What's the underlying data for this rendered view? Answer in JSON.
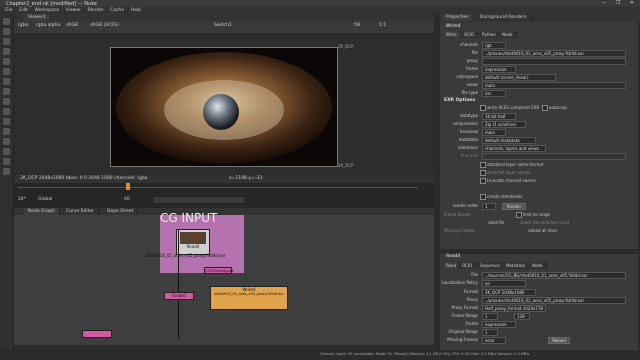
{
  "window": {
    "title": "Chapter2_end.nk [modified] — Nuke"
  },
  "menu": [
    "File",
    "Edit",
    "Workspace",
    "Viewer",
    "Render",
    "Cache",
    "Help"
  ],
  "viewer": {
    "tab_label": "Viewer1",
    "channels": "rgba",
    "channel": "rgba.alpha",
    "colorspace": "sRGB",
    "display": "sRGB (ACES)",
    "wipe": "Switch1",
    "gain": "f/8",
    "gamma": "1",
    "zoom": "1:1",
    "frame": "2K_DCP",
    "res_label": "2K_DCP",
    "info": "2K_DCP 2048x1080  bbox: 0 0 2048 1080 channels: rgba",
    "coords": "x=1198 y=-33"
  },
  "timeline": {
    "fps": "24*",
    "range_mode": "Global",
    "current_frame": "40",
    "ticks": [
      "1",
      "10",
      "20",
      "30",
      "40",
      "50",
      "60",
      "70",
      "80",
      "90",
      "100",
      "110",
      "120",
      "130"
    ]
  },
  "nodegraph_tabs": [
    "Node Graph",
    "Curve Editor",
    "Dope Sheet"
  ],
  "nodes": {
    "backdrop_label": "CG INPUT",
    "read_node": "Read4",
    "read_file": "shot0010_01_aces_v05_proxy.%04d.exr",
    "write_node": "Write4",
    "write_file": "shot0010_01_aces_v05_proxy.%04d.exr",
    "colorspace_node": "OCIOColorSpace",
    "dot_label": "Grade1"
  },
  "props_tabs": [
    "Properties",
    "Background Renders"
  ],
  "write_props": {
    "node_name": "Write4",
    "tabs": [
      "Write",
      "OCIO",
      "Python",
      "Node"
    ],
    "rows": [
      {
        "label": "channels",
        "value": "rgb"
      },
      {
        "label": "file",
        "value": "../proxies/shot0010_01_aces_v05_proxy.%04d.exr"
      },
      {
        "label": "proxy",
        "value": ""
      },
      {
        "label": "frame",
        "value": "expression"
      },
      {
        "label": "colorspace",
        "value": "default (scene_linear)"
      },
      {
        "label": "views",
        "value": "main"
      },
      {
        "label": "file type",
        "value": "exr"
      }
    ],
    "section": "EXR Options",
    "checks": {
      "aces_compliant": "write ACES compliant EXR",
      "autocrop": "autocrop"
    },
    "rows2": [
      {
        "label": "datatype",
        "value": "16 bit half"
      },
      {
        "label": "compression",
        "value": "Zip (1 scanline)"
      },
      {
        "label": "heroview",
        "value": "main"
      },
      {
        "label": "metadata",
        "value": "default metadata"
      },
      {
        "label": "interleave",
        "value": "channels, layers and views"
      },
      {
        "label": "first part",
        "value": ""
      }
    ],
    "more_checks": [
      "standard layer name format",
      "write full layer names",
      "truncate channel names",
      "create directories"
    ],
    "render_order": {
      "label": "render order",
      "value": "1"
    },
    "render_btn": "Render",
    "frame_range_label": "Frame Range",
    "limit_to_range": "limit to range",
    "read_file": "read file",
    "check_file": "check file matches input",
    "missing_frames": "Missing Frames",
    "reload": "reload all lines"
  },
  "read_props": {
    "node_name": "Read4",
    "tabs": [
      "Read",
      "OCIO",
      "Sequence",
      "Metadata",
      "Node"
    ],
    "rows": [
      {
        "label": "File",
        "value": "../sources/CG_BG/shot0010_01_aces_v05.%04d.exr"
      },
      {
        "label": "Localization Policy",
        "value": "on"
      },
      {
        "label": "Format",
        "value": "2K_DCP 2048x1080"
      },
      {
        "label": "Proxy",
        "value": "../proxies/shot0010_01_aces_v05_proxy.%04d.exr"
      },
      {
        "label": "Proxy Format",
        "value": "Half_proxy_format 1024x778"
      },
      {
        "label": "Frame Range",
        "value": "1"
      },
      {
        "label": "Frame",
        "value": "expression"
      },
      {
        "label": "Original Range",
        "value": "1"
      },
      {
        "label": "Missing Frames",
        "value": "error"
      }
    ],
    "frame_end": "128",
    "reload": "Reload"
  },
  "status": "Channel Count: 55  Localization Mode: On (Paused)  Memory: 2.1 GB (5.9%)  CPU: 0.3%  Disk: 0.0 MB/s  Network: 0.0 MB/s",
  "colors": {
    "backdrop": "#c97bc2",
    "read_node": "#cfcfcf",
    "write_node": "#e0a24b",
    "grade": "#c95eab",
    "dot": "#d35aa0"
  }
}
